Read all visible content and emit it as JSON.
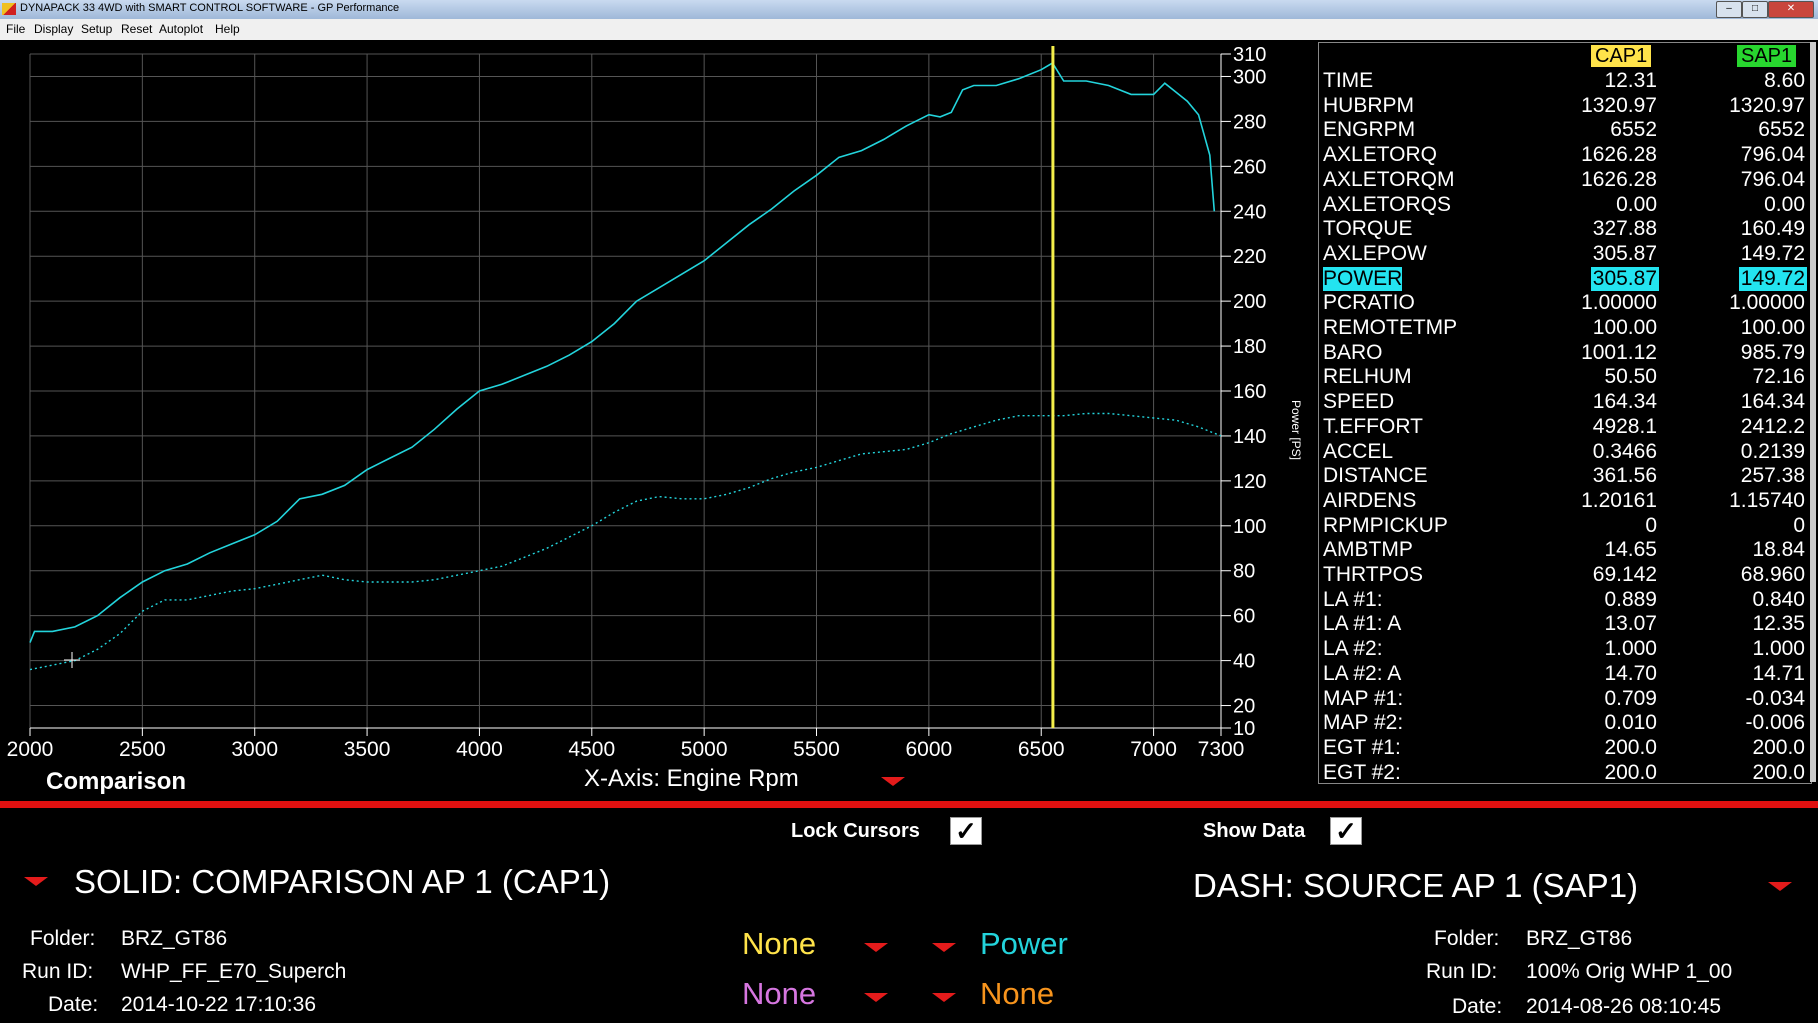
{
  "window": {
    "title": "DYNAPACK 33 4WD with SMART CONTROL SOFTWARE - GP Performance",
    "minimize_glyph": "–",
    "maximize_glyph": "□",
    "close_glyph": "✕"
  },
  "menu": [
    "File",
    "Display",
    "Setup",
    "Reset",
    "Autoplot",
    "Help"
  ],
  "chart_data": {
    "type": "line",
    "x_ticks": [
      "2000",
      "2500",
      "3000",
      "3500",
      "4000",
      "4500",
      "5000",
      "5500",
      "6000",
      "6500",
      "7000",
      "7300"
    ],
    "y_ticks": [
      "10",
      "20",
      "40",
      "60",
      "80",
      "100",
      "120",
      "140",
      "160",
      "180",
      "200",
      "220",
      "240",
      "260",
      "280",
      "300",
      "310"
    ],
    "xlim": [
      2000,
      7300
    ],
    "ylim": [
      10,
      310
    ],
    "xlabel": "X-Axis: Engine Rpm",
    "ylabel": "Power [PS]",
    "grid": true,
    "cursor_x": 6552,
    "series": [
      {
        "style": "solid",
        "color": "#23d4dc",
        "x": [
          2000,
          2020,
          2100,
          2200,
          2300,
          2400,
          2500,
          2600,
          2700,
          2800,
          2900,
          3000,
          3100,
          3200,
          3300,
          3400,
          3500,
          3600,
          3700,
          3800,
          3900,
          4000,
          4100,
          4200,
          4300,
          4400,
          4500,
          4600,
          4700,
          4800,
          4900,
          5000,
          5100,
          5200,
          5300,
          5400,
          5500,
          5600,
          5700,
          5800,
          5900,
          6000,
          6050,
          6100,
          6150,
          6200,
          6300,
          6400,
          6500,
          6550,
          6600,
          6700,
          6800,
          6900,
          7000,
          7050,
          7100,
          7150,
          7200,
          7250,
          7270
        ],
        "y": [
          48,
          53,
          53,
          55,
          60,
          68,
          75,
          80,
          83,
          88,
          92,
          96,
          102,
          112,
          114,
          118,
          125,
          130,
          135,
          143,
          152,
          160,
          163,
          167,
          171,
          176,
          182,
          190,
          200,
          206,
          212,
          218,
          226,
          234,
          241,
          249,
          256,
          264,
          267,
          272,
          278,
          283,
          282,
          284,
          294,
          296,
          296,
          299,
          303,
          306,
          298,
          298,
          296,
          292,
          292,
          297,
          293,
          289,
          283,
          265,
          240
        ]
      },
      {
        "style": "dotted",
        "color": "#23d4dc",
        "x": [
          2000,
          2100,
          2200,
          2300,
          2400,
          2500,
          2600,
          2700,
          2800,
          2900,
          3000,
          3100,
          3200,
          3300,
          3400,
          3500,
          3600,
          3700,
          3800,
          3900,
          4000,
          4100,
          4200,
          4300,
          4400,
          4500,
          4600,
          4700,
          4800,
          4900,
          5000,
          5100,
          5200,
          5300,
          5400,
          5500,
          5600,
          5700,
          5800,
          5900,
          6000,
          6100,
          6200,
          6300,
          6400,
          6500,
          6600,
          6700,
          6800,
          6900,
          7000,
          7100,
          7200,
          7300
        ],
        "y": [
          36,
          38,
          40,
          45,
          52,
          62,
          67,
          67,
          69,
          71,
          72,
          74,
          76,
          78,
          76,
          75,
          75,
          75,
          76,
          78,
          80,
          82,
          86,
          90,
          95,
          100,
          106,
          111,
          113,
          112,
          112,
          114,
          117,
          121,
          124,
          126,
          129,
          132,
          133,
          134,
          137,
          141,
          144,
          147,
          149,
          149,
          149,
          150,
          150,
          149,
          148,
          147,
          144,
          140
        ]
      }
    ]
  },
  "data_panel": {
    "col1_header": "CAP1",
    "col2_header": "SAP1",
    "col1_color": "#ffe34a",
    "col2_color": "#28d62f",
    "rows": [
      {
        "name": "TIME",
        "v1": "12.31",
        "v2": "8.60"
      },
      {
        "name": "HUBRPM",
        "v1": "1320.97",
        "v2": "1320.97"
      },
      {
        "name": "ENGRPM",
        "v1": "6552",
        "v2": "6552"
      },
      {
        "name": "AXLETORQ",
        "v1": "1626.28",
        "v2": "796.04"
      },
      {
        "name": "AXLETORQM",
        "v1": "1626.28",
        "v2": "796.04"
      },
      {
        "name": "AXLETORQS",
        "v1": "0.00",
        "v2": "0.00"
      },
      {
        "name": "TORQUE",
        "v1": "327.88",
        "v2": "160.49"
      },
      {
        "name": "AXLEPOW",
        "v1": "305.87",
        "v2": "149.72"
      },
      {
        "name": "POWER",
        "v1": "305.87",
        "v2": "149.72",
        "highlight": true
      },
      {
        "name": "PCRATIO",
        "v1": "1.00000",
        "v2": "1.00000"
      },
      {
        "name": "REMOTETMP",
        "v1": "100.00",
        "v2": "100.00"
      },
      {
        "name": "BARO",
        "v1": "1001.12",
        "v2": "985.79"
      },
      {
        "name": "RELHUM",
        "v1": "50.50",
        "v2": "72.16"
      },
      {
        "name": "SPEED",
        "v1": "164.34",
        "v2": "164.34"
      },
      {
        "name": "T.EFFORT",
        "v1": "4928.1",
        "v2": "2412.2"
      },
      {
        "name": "ACCEL",
        "v1": "0.3466",
        "v2": "0.2139"
      },
      {
        "name": "DISTANCE",
        "v1": "361.56",
        "v2": "257.38"
      },
      {
        "name": "AIRDENS",
        "v1": "1.20161",
        "v2": "1.15740"
      },
      {
        "name": "RPMPICKUP",
        "v1": "0",
        "v2": "0"
      },
      {
        "name": "AMBTMP",
        "v1": "14.65",
        "v2": "18.84"
      },
      {
        "name": "THRTPOS",
        "v1": "69.142",
        "v2": "68.960"
      },
      {
        "name": "LA #1:",
        "v1": "0.889",
        "v2": "0.840"
      },
      {
        "name": "LA #1: A",
        "v1": "13.07",
        "v2": "12.35"
      },
      {
        "name": "LA #2:",
        "v1": "1.000",
        "v2": "1.000"
      },
      {
        "name": "LA #2: A",
        "v1": "14.70",
        "v2": "14.71"
      },
      {
        "name": "MAP #1:",
        "v1": "0.709",
        "v2": "-0.034"
      },
      {
        "name": "MAP #2:",
        "v1": "0.010",
        "v2": "-0.006"
      },
      {
        "name": "EGT #1:",
        "v1": "200.0",
        "v2": "200.0"
      },
      {
        "name": "EGT #2:",
        "v1": "200.0",
        "v2": "200.0"
      }
    ]
  },
  "chart_mode": "Comparison",
  "controls": {
    "lock_cursors": "Lock Cursors",
    "show_data": "Show Data",
    "check_glyph": "✓"
  },
  "solid": {
    "title": "SOLID: COMPARISON AP 1 (CAP1)",
    "folder_label": "Folder:",
    "folder": "BRZ_GT86",
    "run_label": "Run ID:",
    "run": "WHP_FF_E70_Superch",
    "date_label": "Date:",
    "date": "2014-10-22 17:10:36"
  },
  "dash": {
    "title": "DASH: SOURCE AP 1 (SAP1)",
    "folder_label": "Folder:",
    "folder": "BRZ_GT86",
    "run_label": "Run ID:",
    "run": "100% Orig WHP 1_00",
    "date_label": "Date:",
    "date": "2014-08-26 08:10:45"
  },
  "channels": {
    "c1": {
      "label": "None",
      "color": "#ffe34a"
    },
    "c2": {
      "label": "Power",
      "color": "#23d4dc"
    },
    "c3": {
      "label": "None",
      "color": "#d676e0"
    },
    "c4": {
      "label": "None",
      "color": "#f7941d"
    }
  }
}
